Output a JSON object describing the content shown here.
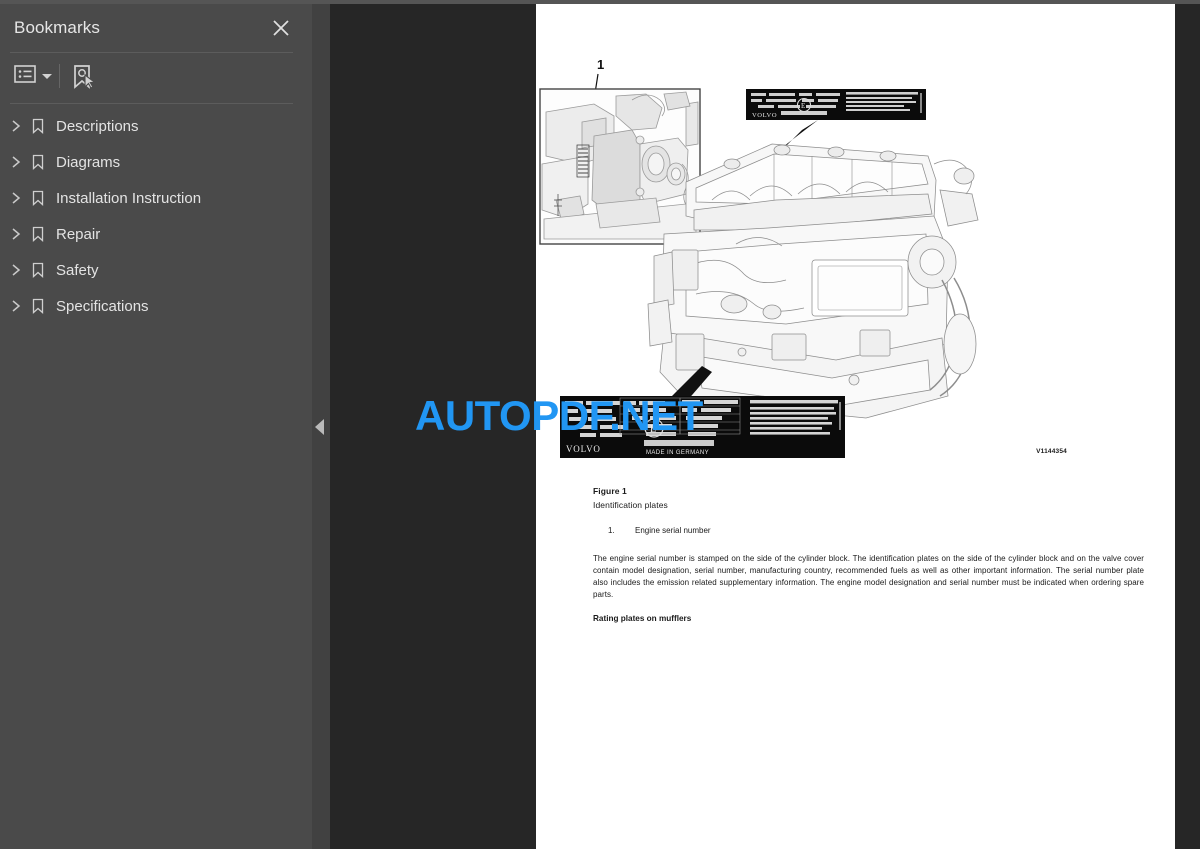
{
  "sidebar": {
    "title": "Bookmarks",
    "close_icon": "close-icon",
    "toolbar": {
      "list_options_icon": "list-options-icon",
      "caret_icon": "chevron-down-icon",
      "new_bookmark_icon": "new-bookmark-icon"
    },
    "items": [
      {
        "label": "Descriptions",
        "expand_icon": "chevron-right-icon",
        "icon": "bookmark-icon"
      },
      {
        "label": "Diagrams",
        "expand_icon": "chevron-right-icon",
        "icon": "bookmark-icon"
      },
      {
        "label": "Installation Instruction",
        "expand_icon": "chevron-right-icon",
        "icon": "bookmark-icon"
      },
      {
        "label": "Repair",
        "expand_icon": "chevron-right-icon",
        "icon": "bookmark-icon"
      },
      {
        "label": "Safety",
        "expand_icon": "chevron-right-icon",
        "icon": "bookmark-icon"
      },
      {
        "label": "Specifications",
        "expand_icon": "chevron-right-icon",
        "icon": "bookmark-icon"
      }
    ]
  },
  "splitter": {
    "collapse_icon": "collapse-left-icon"
  },
  "document": {
    "figure_callout": "1",
    "figure_id": "V1144354",
    "figure_title": "Figure 1",
    "figure_subtitle": "Identification plates",
    "list": [
      {
        "index": "1.",
        "text": "Engine serial number"
      }
    ],
    "paragraph": "The engine serial number is stamped on the side of the cylinder block. The identification plates on the side of the cylinder block and on the valve cover contain model designation, serial number, manufacturing country, recommended fuels as well as other important information. The serial number plate also includes the emission related supplementary information. The engine model designation and serial number must be indicated when ordering spare parts.",
    "subheading": "Rating plates on mufflers",
    "plates": {
      "brand": "VOLVO",
      "origin": "MADE IN GERMANY",
      "heading": "EMISSION CONTROL INFORMATION",
      "fields": [
        "MODEL",
        "SER NO",
        "C-SPEC",
        "SPEC",
        "ABIT",
        "DISP"
      ],
      "emblem": "E"
    }
  },
  "watermark": {
    "text": "AUTOPDF.NET",
    "color": "#2196f3"
  },
  "colors": {
    "sidebar_bg": "#4a4a4a",
    "viewer_bg": "#262626",
    "splitter_bg": "#414141",
    "page_bg": "#ffffff",
    "text_light": "#e3e3e3"
  }
}
